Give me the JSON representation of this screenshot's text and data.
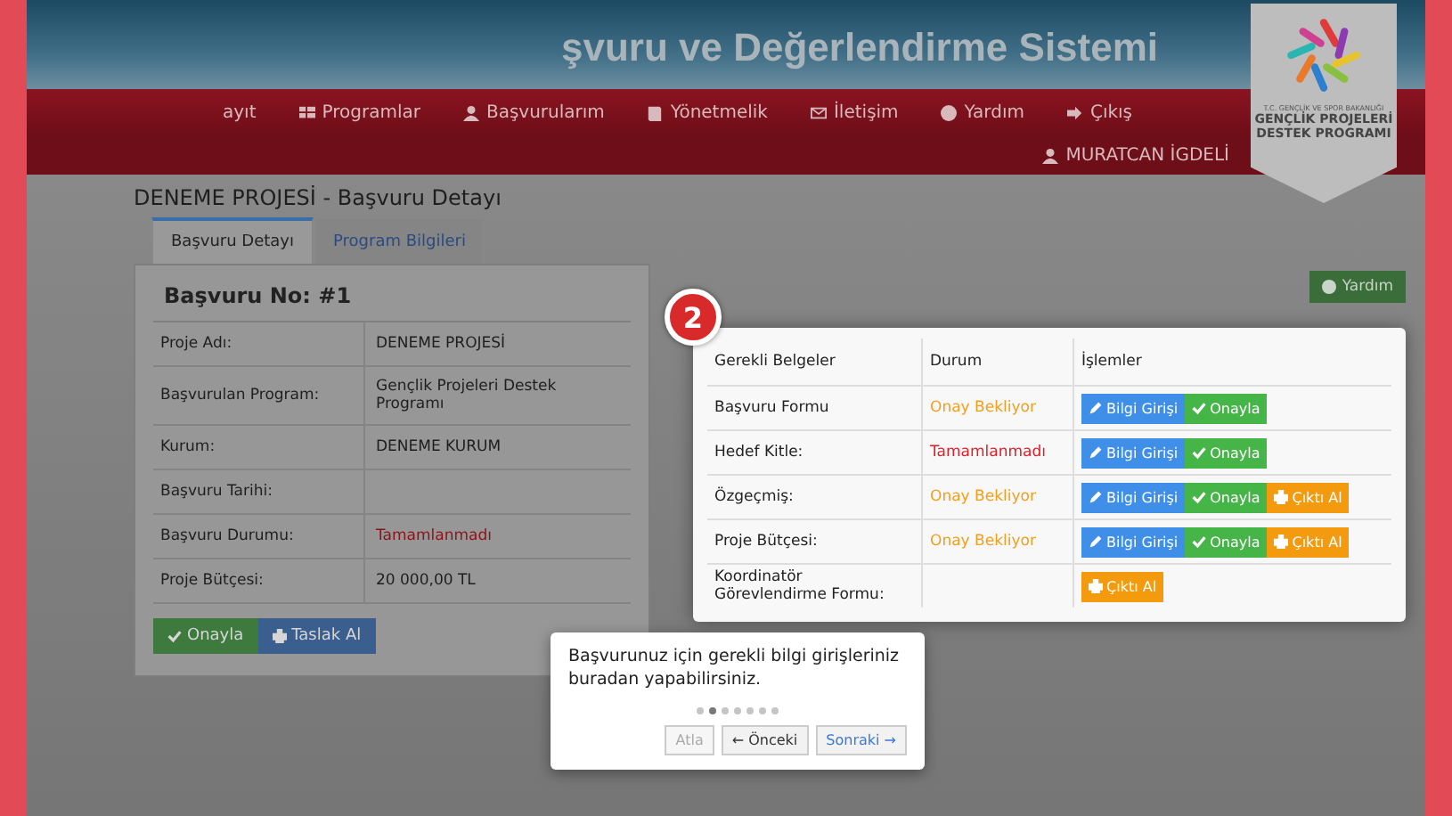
{
  "header": {
    "title": "şvuru ve Değerlendirme Sistemi",
    "logo_caption": [
      "T.C. GENÇLİK VE SPOR BAKANLIĞI",
      "GENÇLİK PROJELERİ",
      "DESTEK PROGRAMI"
    ]
  },
  "nav": [
    {
      "label": "ayıt"
    },
    {
      "label": "Programlar"
    },
    {
      "label": "Başvurularım"
    },
    {
      "label": "Yönetmelik"
    },
    {
      "label": "İletişim"
    },
    {
      "label": "Yardım"
    },
    {
      "label": "Çıkış"
    }
  ],
  "user": {
    "name": "MURATCAN İGDELİ"
  },
  "page_title": "DENEME PROJESİ - Başvuru Detayı",
  "tabs": [
    {
      "label": "Başvuru Detayı",
      "selected": true
    },
    {
      "label": "Program Bilgileri",
      "selected": false
    }
  ],
  "application": {
    "heading": "Başvuru No: #1",
    "fields": [
      {
        "label": "Proje Adı:",
        "value": "DENEME PROJESİ",
        "kind": "text"
      },
      {
        "label": "Başvurulan Program:",
        "value": "Gençlik Projeleri Destek Programı",
        "kind": "text"
      },
      {
        "label": "Kurum:",
        "value": "DENEME KURUM",
        "kind": "text"
      },
      {
        "label": "Başvuru Tarihi:"
      },
      {
        "label": "Başvuru Durumu:",
        "value": "Tamamlanmadı",
        "kind": "danger"
      },
      {
        "label": "Proje Bütçesi:",
        "value": "20 000,00 TL",
        "kind": "text"
      }
    ],
    "actions": [
      {
        "label": "Onayla",
        "kind": "approve"
      },
      {
        "label": "Taslak Al",
        "kind": "print"
      }
    ]
  },
  "help_button": "Yardım",
  "documents": {
    "step": "2",
    "columns": [
      "Gerekli Belgeler",
      "Durum",
      "İşlemler"
    ],
    "rows": [
      {
        "name": "Başvuru Formu",
        "status": "Onay Bekliyor",
        "kind": "pending",
        "buttons": [
          {
            "label": "Bilgi Girişi",
            "kind": "edit"
          },
          {
            "label": "Onayla",
            "kind": "approve"
          }
        ]
      },
      {
        "name": "Hedef Kitle:",
        "status": "Tamamlanmadı",
        "kind": "incomplete",
        "buttons": [
          {
            "label": "Bilgi Girişi",
            "kind": "edit"
          },
          {
            "label": "Onayla",
            "kind": "approve"
          }
        ]
      },
      {
        "name": "Özgeçmiş:",
        "status": "Onay Bekliyor",
        "kind": "pending",
        "buttons": [
          {
            "label": "Bilgi Girişi",
            "kind": "edit"
          },
          {
            "label": "Onayla",
            "kind": "approve"
          },
          {
            "label": "Çıktı Al",
            "kind": "print"
          }
        ]
      },
      {
        "name": "Proje Bütçesi:",
        "status": "Onay Bekliyor",
        "kind": "pending",
        "buttons": [
          {
            "label": "Bilgi Girişi",
            "kind": "edit"
          },
          {
            "label": "Onayla",
            "kind": "approve"
          },
          {
            "label": "Çıktı Al",
            "kind": "print"
          }
        ]
      },
      {
        "name": "Koordinatör Görevlendirme Formu:",
        "kind": "none",
        "buttons": [
          {
            "label": "Çıktı Al",
            "kind": "print"
          }
        ]
      }
    ]
  },
  "tour": {
    "text": "Başvurunuz için gerekli bilgi girişleriniz buradan yapabilirsiniz.",
    "dots": [
      {
        "selected": false
      },
      {
        "selected": true
      },
      {
        "selected": false
      },
      {
        "selected": false
      },
      {
        "selected": false
      },
      {
        "selected": false
      },
      {
        "selected": false
      }
    ],
    "buttons": [
      {
        "label": "Atla",
        "kind": "skip",
        "disabled": true
      },
      {
        "label": "← Önceki",
        "kind": "prev",
        "disabled": false
      },
      {
        "label": "Sonraki →",
        "kind": "next",
        "disabled": false
      }
    ]
  }
}
